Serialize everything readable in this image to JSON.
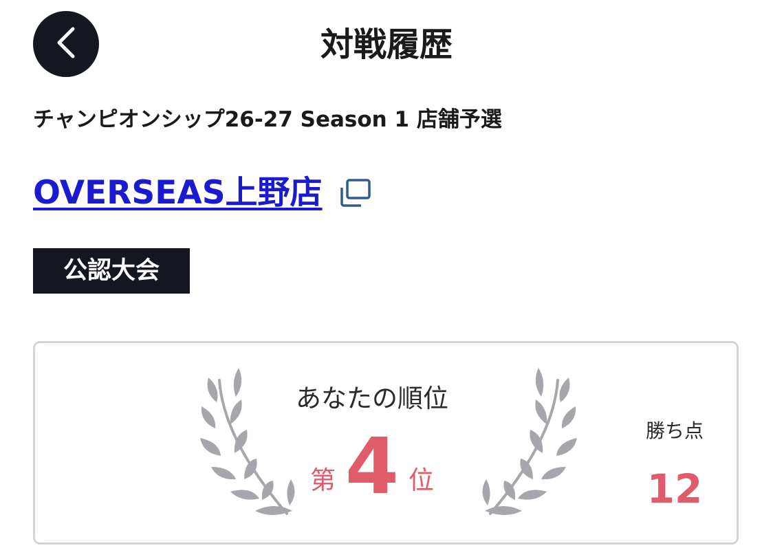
{
  "header": {
    "title": "対戦履歴",
    "back_icon": "chevron-left-icon"
  },
  "event": {
    "name": "チャンピオンシップ26-27 Season 1 店舗予選"
  },
  "store": {
    "name": "OVERSEAS上野店",
    "copy_icon": "copy-icon"
  },
  "badge": {
    "label": "公認大会"
  },
  "result": {
    "heading": "あなたの順位",
    "rank_prefix": "第",
    "rank": "4",
    "rank_suffix": "位",
    "points_label": "勝ち点",
    "points": "12",
    "laurel_icon": "laurel-wreath-icon"
  },
  "colors": {
    "accent": "#e05c6b",
    "dark": "#14171f",
    "link": "#1a1ad0",
    "laurel": "#a6a7ad",
    "card_border": "#d4d4d8"
  }
}
